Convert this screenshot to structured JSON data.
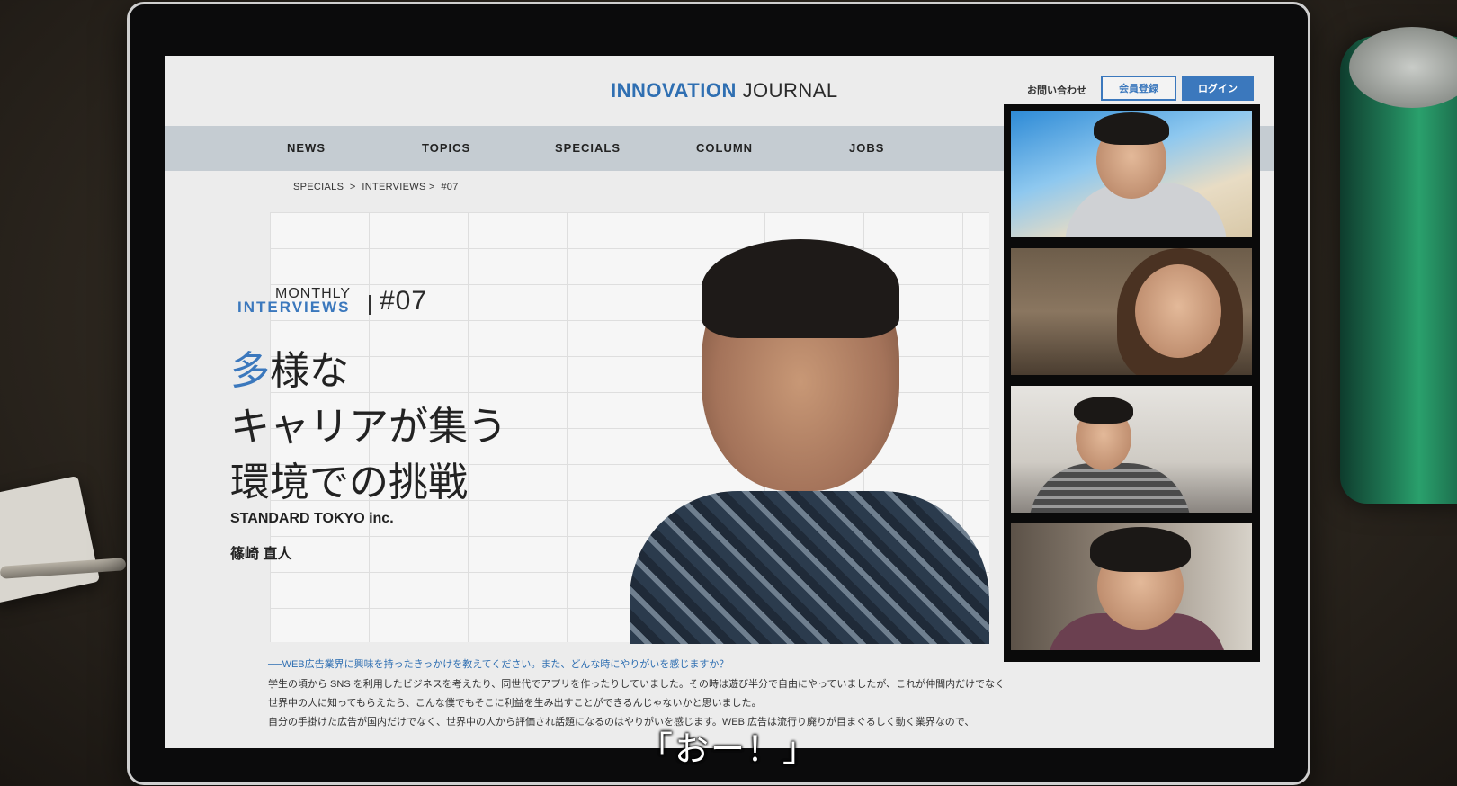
{
  "header": {
    "logo_part1": "INNOVATION",
    "logo_part2": " JOURNAL",
    "contact_link": "お問い合わせ",
    "register_button": "会員登録",
    "login_button": "ログイン"
  },
  "nav": {
    "items": [
      "NEWS",
      "TOPICS",
      "SPECIALS",
      "COLUMN",
      "JOBS"
    ]
  },
  "breadcrumb": "SPECIALS  >  INTERVIEWS >  #07",
  "hero": {
    "series_top": "MONTHLY",
    "series_bottom": "INTERVIEWS",
    "issue_number": "#07",
    "headline_accent": "多",
    "headline_line1_rest": "様な",
    "headline_line2": "キャリアが集う",
    "headline_line3": "環境での挑戦",
    "company": "STANDARD TOKYO inc.",
    "person_name": "篠崎 直人"
  },
  "article": {
    "question": "──WEB広告業界に興味を持ったきっかけを教えてください。また、どんな時にやりがいを感じますか？",
    "paragraphs": [
      "学生の頃から SNS を利用したビジネスを考えたり、同世代でアプリを作ったりしていました。その時は遊び半分で自由にやっていましたが、これが仲間内だけでなく",
      "世界中の人に知ってもらえたら、こんな僕でもそこに利益を生み出すことができるんじゃないかと思いました。",
      "自分の手掛けた広告が国内だけでなく、世界中の人から評価され話題になるのはやりがいを感じます。WEB 広告は流行り廃りが目まぐるしく動く業界なので、"
    ]
  },
  "video_call": {
    "participants": 4
  },
  "subtitle": "「おー！」"
}
